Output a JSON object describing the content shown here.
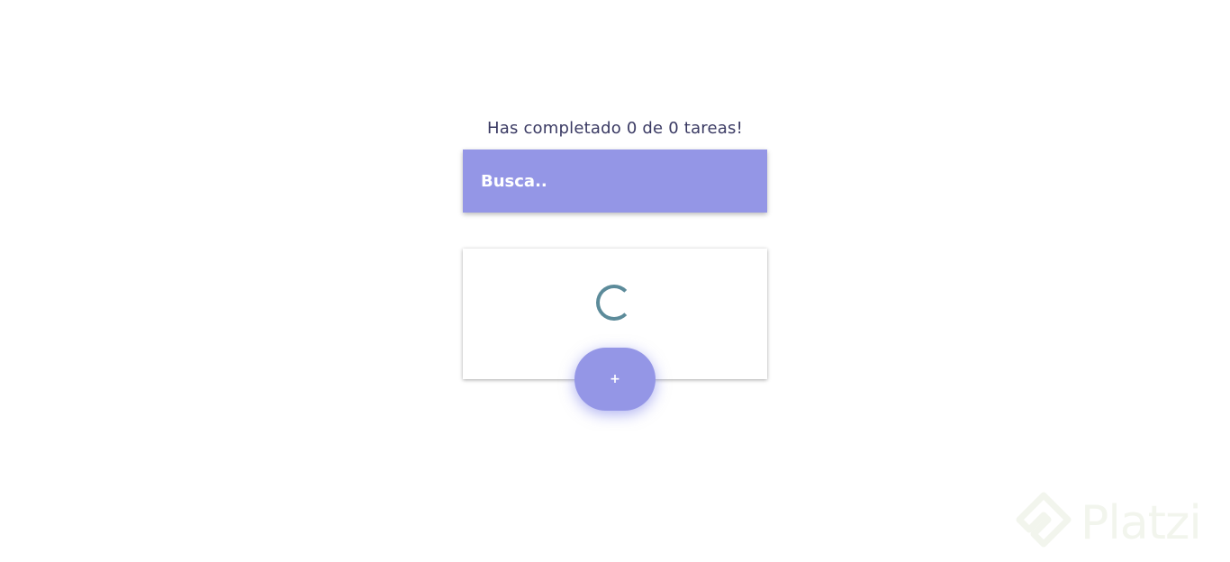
{
  "header": {
    "counter_text": "Has completado 0 de 0 tareas!"
  },
  "search": {
    "placeholder": "Busca.."
  },
  "todo_list": {
    "loading_icon": "loading-spinner-icon"
  },
  "add_button": {
    "label": "+"
  },
  "watermark": {
    "brand": "Platzi",
    "icon": "platzi-logo-icon"
  },
  "colors": {
    "accent": "#9496e6",
    "spinner": "#5c8b9a",
    "text": "#3a3a63"
  }
}
